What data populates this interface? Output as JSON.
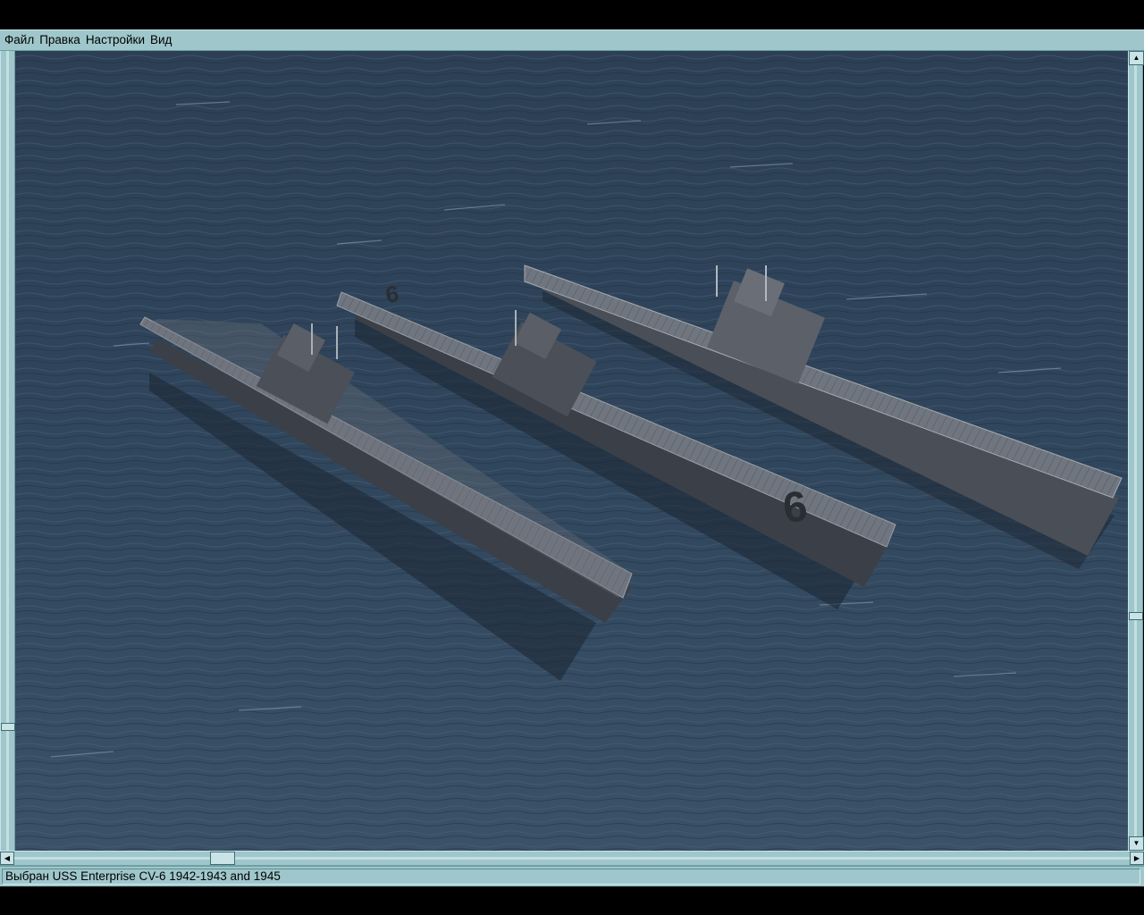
{
  "menu": {
    "items": [
      "Файл",
      "Правка",
      "Настройки",
      "Вид"
    ]
  },
  "status": {
    "text": "Выбран USS Enterprise CV-6 1942-1943 and 1945"
  },
  "scene": {
    "description_free": true,
    "deck_numbers": [
      "6",
      "6"
    ],
    "colors": {
      "sea": "#2d4258",
      "hull": "#3a3f47",
      "deck": "#6f737a",
      "frame": "#9fc7cb"
    }
  }
}
